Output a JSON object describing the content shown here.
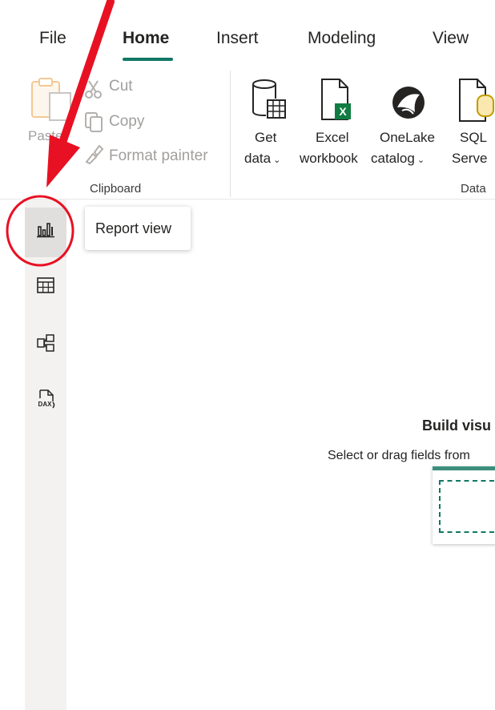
{
  "tabs": [
    "File",
    "Home",
    "Insert",
    "Modeling",
    "View"
  ],
  "active_tab": "Home",
  "clipboard": {
    "paste": "Paste",
    "cut": "Cut",
    "copy": "Copy",
    "format_painter": "Format painter",
    "group_label": "Clipboard"
  },
  "data_group": {
    "get_data": [
      "Get",
      "data"
    ],
    "excel": [
      "Excel",
      "workbook"
    ],
    "onelake": [
      "OneLake",
      "catalog"
    ],
    "sql": [
      "SQL",
      "Serve"
    ],
    "group_label": "Data"
  },
  "left_nav": {
    "tooltip": "Report view",
    "report_icon_label": "Report view",
    "dax_icon_text": "DAX"
  },
  "canvas": {
    "title": "Build visu",
    "subtitle": "Select or drag fields from"
  },
  "colors": {
    "accent": "#117865",
    "annotation": "#e81123",
    "excel": "#107c41",
    "sql": "#c19c00"
  }
}
